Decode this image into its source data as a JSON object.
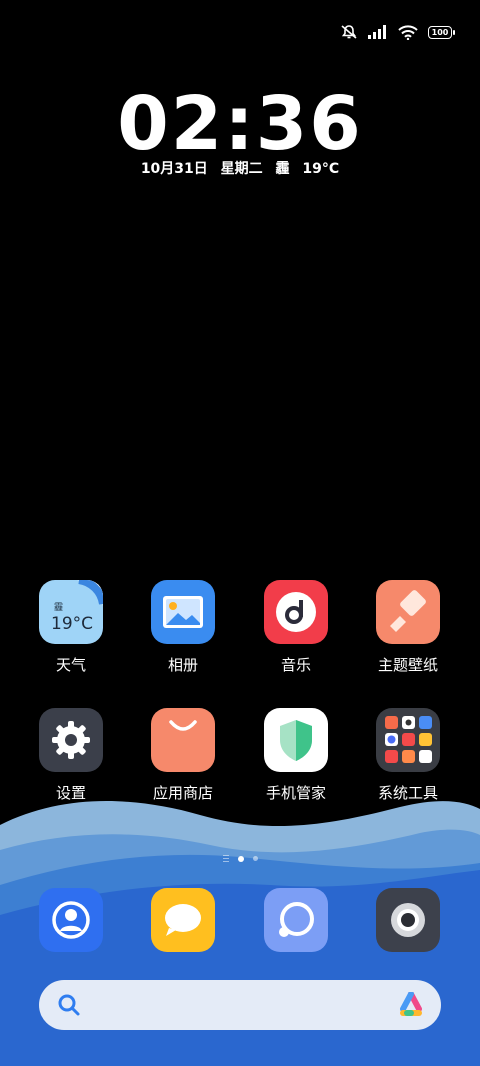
{
  "status_bar": {
    "icons": [
      "mute-icon",
      "signal-icon",
      "wifi-icon",
      "battery-icon"
    ],
    "battery_level": "100"
  },
  "clock": {
    "time": "02:36"
  },
  "date_line": {
    "date": "10月31日",
    "weekday": "星期二",
    "weather": "霾",
    "temperature": "19°C"
  },
  "apps": [
    {
      "label": "天气",
      "icon": "weather-icon",
      "icon_text_top": "霾",
      "icon_text_bottom": "19°C"
    },
    {
      "label": "相册",
      "icon": "gallery-icon"
    },
    {
      "label": "音乐",
      "icon": "music-icon"
    },
    {
      "label": "主题壁纸",
      "icon": "themes-icon"
    },
    {
      "label": "设置",
      "icon": "gear-icon"
    },
    {
      "label": "应用商店",
      "icon": "app-store-icon"
    },
    {
      "label": "手机管家",
      "icon": "security-shield-icon"
    },
    {
      "label": "系统工具",
      "icon": "folder-icon"
    }
  ],
  "page_indicator": {
    "pages": 2,
    "current": 1
  },
  "dock": [
    {
      "icon": "contacts-icon"
    },
    {
      "icon": "messages-icon"
    },
    {
      "icon": "browser-icon"
    },
    {
      "icon": "camera-icon"
    }
  ],
  "search_bar": {
    "icon": "search-icon",
    "assistant_icon": "assistant-logo-icon"
  },
  "colors": {
    "wave_back": "#8cb6dc",
    "wave_mid": "#3d7fd2",
    "wave_front": "#2a67cf"
  }
}
